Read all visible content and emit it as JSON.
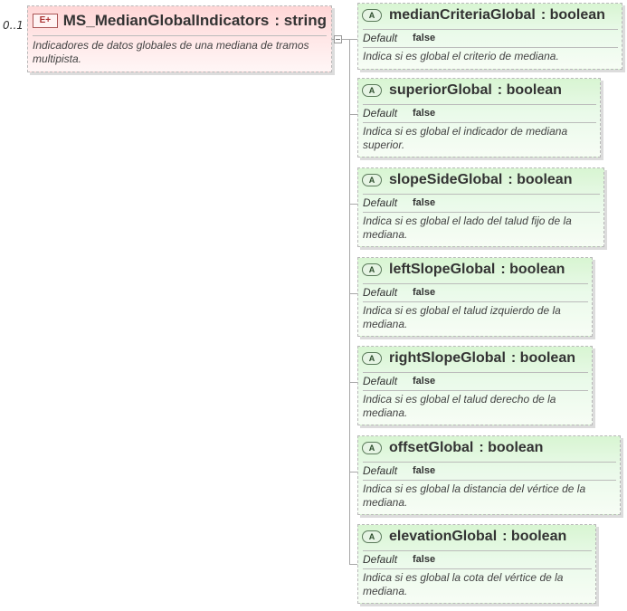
{
  "element": {
    "multiplicity": "0..1",
    "badge": "E+",
    "name": "MS_MedianGlobalIndicators",
    "type": ": string",
    "description": "Indicadores de datos globales de una mediana de tramos multipista."
  },
  "attribute_badge": "A",
  "default_label": "Default",
  "attributes": [
    {
      "name": "medianCriteriaGlobal",
      "type": ": boolean",
      "default": "false",
      "description": "Indica si es global el criterio de mediana."
    },
    {
      "name": "superiorGlobal",
      "type": ": boolean",
      "default": "false",
      "description": "Indica si es global el indicador de mediana superior."
    },
    {
      "name": "slopeSideGlobal",
      "type": ": boolean",
      "default": "false",
      "description": "Indica si es global el lado del talud fijo de la mediana."
    },
    {
      "name": "leftSlopeGlobal",
      "type": ": boolean",
      "default": "false",
      "description": "Indica si es global el talud izquierdo de la mediana."
    },
    {
      "name": "rightSlopeGlobal",
      "type": ": boolean",
      "default": "false",
      "description": "Indica si es global el talud derecho de la mediana."
    },
    {
      "name": "offsetGlobal",
      "type": ": boolean",
      "default": "false",
      "description": "Indica si es global la distancia del vértice de la mediana."
    },
    {
      "name": "elevationGlobal",
      "type": ": boolean",
      "default": "false",
      "description": "Indica si es global la cota del vértice de la mediana."
    }
  ]
}
